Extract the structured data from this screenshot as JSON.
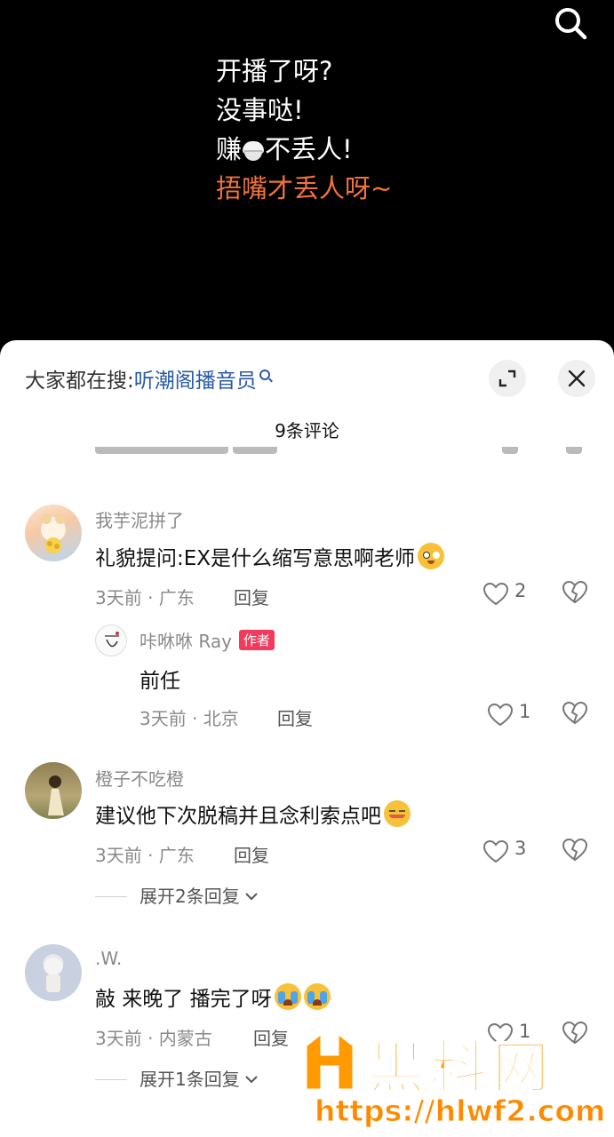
{
  "lyrics": [
    {
      "before": "开播了呀?",
      "after": ""
    },
    {
      "before": "没事哒!",
      "after": ""
    },
    {
      "before": "赚",
      "after": "不丢人!"
    },
    {
      "before": "捂嘴才丢人呀~",
      "after": ""
    }
  ],
  "colors": {
    "highlight": "#f0743a",
    "keyword": "#2a5aa8",
    "author_badge": "#f23a5c"
  },
  "sheet": {
    "trending_prefix": "大家都在搜:",
    "trending_keyword": "听潮阁播音员",
    "comment_count": "9条评论"
  },
  "comments": [
    {
      "user": "我芋泥拼了",
      "text": "礼貌提问:EX是什么缩写意思啊老师",
      "meta": "3天前 · 广东",
      "reply_label": "回复",
      "likes": "2",
      "reply": {
        "user": "咔咻咻 Ray",
        "badge": "作者",
        "text": "前任",
        "meta": "3天前 · 北京",
        "reply_label": "回复",
        "likes": "1"
      }
    },
    {
      "user": "橙子不吃橙",
      "text": "建议他下次脱稿并且念利索点吧",
      "meta": "3天前 · 广东",
      "reply_label": "回复",
      "likes": "3",
      "expand": "展开2条回复"
    },
    {
      "user": ".W.",
      "text": "敲 来晚了 播完了呀",
      "meta": "3天前 · 内蒙古",
      "reply_label": "回复",
      "likes": "1",
      "expand": "展开1条回复"
    }
  ],
  "watermark": {
    "title": "黑料网",
    "url": "https://hlwf2.com"
  }
}
